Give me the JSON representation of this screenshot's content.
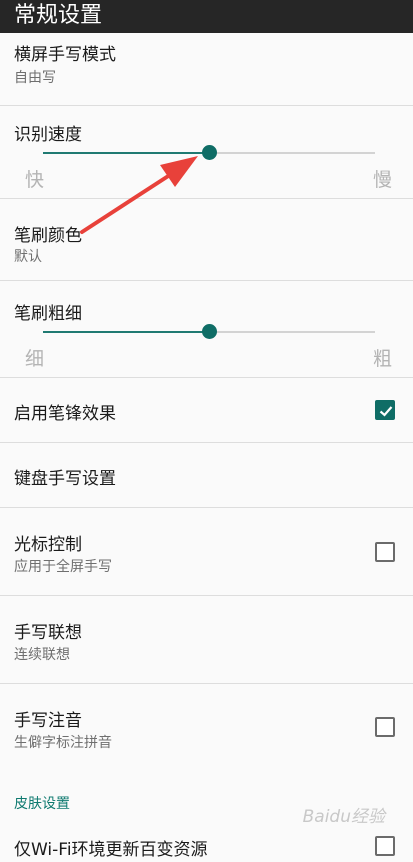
{
  "header": {
    "title": "常规设置"
  },
  "items": {
    "landscape": {
      "title": "横屏手写模式",
      "subtitle": "自由写"
    },
    "speed": {
      "title": "识别速度",
      "min_label": "快",
      "max_label": "慢",
      "value": 0.5
    },
    "color": {
      "title": "笔刷颜色",
      "subtitle": "默认"
    },
    "thickness": {
      "title": "笔刷粗细",
      "min_label": "细",
      "max_label": "粗",
      "value": 0.5
    },
    "stroke_effect": {
      "title": "启用笔锋效果",
      "checked": true
    },
    "keyboard_handwriting": {
      "title": "键盘手写设置"
    },
    "cursor": {
      "title": "光标控制",
      "subtitle": "应用于全屏手写",
      "checked": false
    },
    "association": {
      "title": "手写联想",
      "subtitle": "连续联想"
    },
    "pinyin": {
      "title": "手写注音",
      "subtitle": "生僻字标注拼音",
      "checked": false
    },
    "skin_section": {
      "title": "皮肤设置"
    },
    "wifi_update": {
      "title": "仅Wi-Fi环境更新百变资源",
      "checked": false
    }
  },
  "watermark": {
    "text": "Baidu经验"
  },
  "colors": {
    "accent": "#0f6d66",
    "header_bg": "#262626",
    "arrow": "#e8413a"
  }
}
